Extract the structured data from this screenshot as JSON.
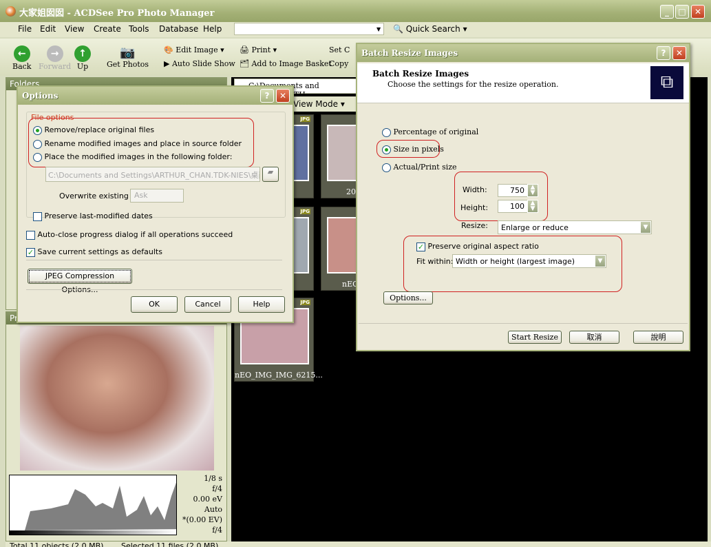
{
  "window": {
    "title": "大家姐囡囡 - ACDSee Pro Photo Manager"
  },
  "menu": [
    "File",
    "Edit",
    "View",
    "Create",
    "Tools",
    "Database",
    "Help"
  ],
  "quick_search": "Quick Search",
  "toolbar": {
    "back": "Back",
    "forward": "Forward",
    "up": "Up",
    "get_photos": "Get Photos",
    "edit_image": "Edit Image",
    "auto_slide_show": "Auto Slide Show",
    "print": "Print",
    "add_basket": "Add to Image Basket",
    "set": "Set C",
    "copy": "Copy"
  },
  "folders": {
    "title": "Folders"
  },
  "preview": {
    "title": "Pr"
  },
  "path": "C:\\Documents and Settings\\ARTH",
  "view_mode": "View Mode",
  "thumbs": [
    {
      "caption": "pg"
    },
    {
      "caption": "200710"
    },
    {
      "caption": "pg"
    },
    {
      "caption": "nEO_IMG"
    },
    {
      "caption": "nEO_IMG_IMG_6215..."
    }
  ],
  "exif": [
    "1/8 s",
    "f/4",
    "0.00 eV",
    "Auto",
    "*(0.00 EV)",
    "f/4"
  ],
  "status": {
    "total": "Total 11 objects (2.0 MB)",
    "selected": "Selected 11 files (2.0 MB)"
  },
  "options": {
    "title": "Options",
    "group": "File options",
    "radios": [
      {
        "label": "Remove/replace original files",
        "checked": true
      },
      {
        "label": "Rename modified images and place in source folder",
        "checked": false
      },
      {
        "label": "Place the modified images in the following folder:",
        "checked": false
      }
    ],
    "folder_value": "C:\\Documents and Settings\\ARTHUR_CHAN.TDK-NIES\\桌面",
    "overwrite_label": "Overwrite existing",
    "overwrite_value": "Ask",
    "preserve_dates": "Preserve last-modified dates",
    "auto_close": "Auto-close progress dialog if all operations succeed",
    "save_defaults": "Save current settings as defaults",
    "jpeg": "JPEG Compression Options...",
    "ok": "OK",
    "cancel": "Cancel",
    "help": "Help"
  },
  "batch": {
    "window_title": "Batch Resize Images",
    "heading": "Batch Resize Images",
    "subheading": "Choose the settings for the resize operation.",
    "radios": [
      {
        "label": "Percentage of original",
        "checked": false
      },
      {
        "label": "Size in pixels",
        "checked": true
      },
      {
        "label": "Actual/Print size",
        "checked": false
      }
    ],
    "width_label": "Width:",
    "width": "750",
    "height_label": "Height:",
    "height": "100",
    "resize_label": "Resize:",
    "resize_value": "Enlarge or reduce",
    "preserve": "Preserve original aspect ratio",
    "preserve_checked": true,
    "fit_label": "Fit within:",
    "fit_value": "Width or height (largest image)",
    "options": "Options...",
    "start": "Start Resize",
    "cancel": "取消",
    "help": "說明"
  },
  "colors": {
    "annotation": "#d02020",
    "theme": "#a4b078"
  }
}
